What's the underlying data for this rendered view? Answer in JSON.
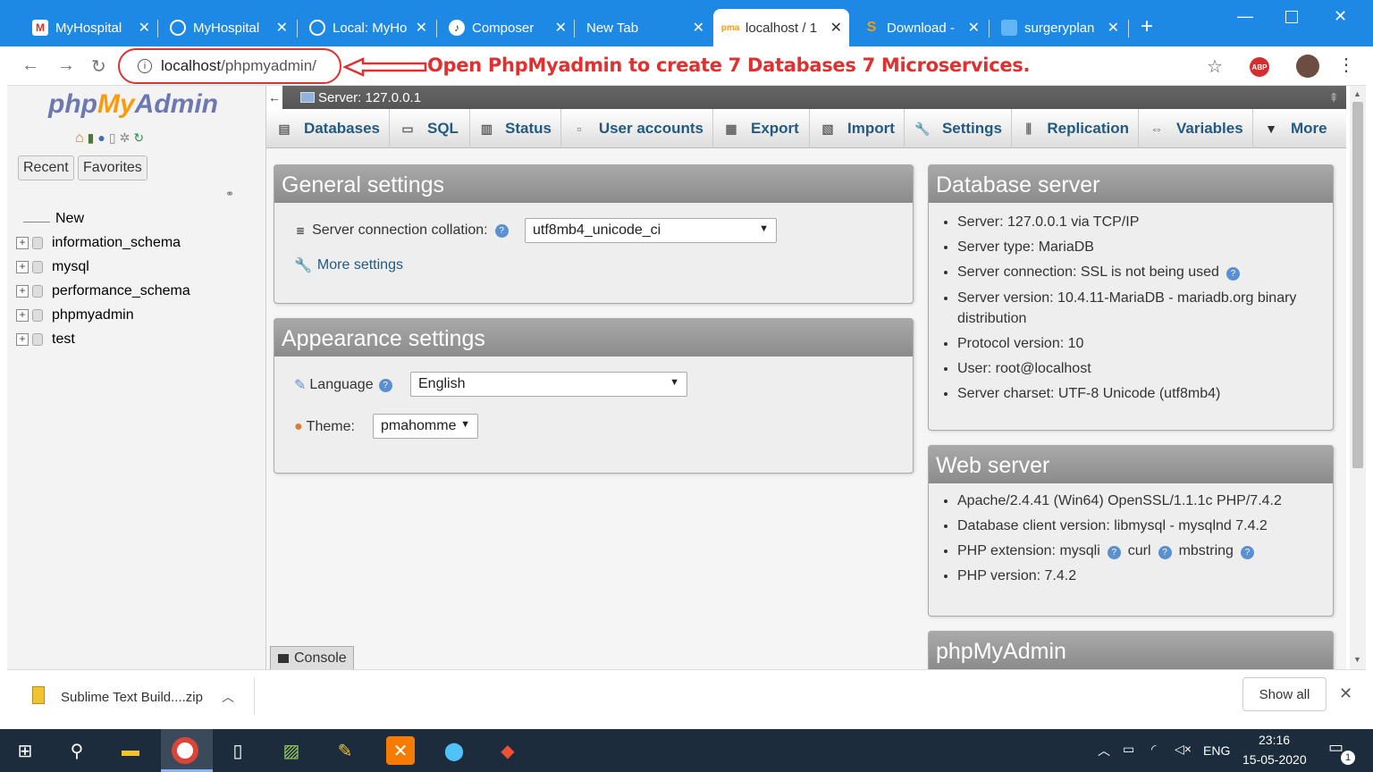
{
  "browser": {
    "tabs": [
      {
        "title": "MyHospital",
        "icon": "gmail-icon"
      },
      {
        "title": "MyHospital",
        "icon": "globe-icon"
      },
      {
        "title": "Local: MyHo",
        "icon": "globe-icon"
      },
      {
        "title": "Composer",
        "icon": "composer-icon"
      },
      {
        "title": "New Tab",
        "icon": ""
      },
      {
        "title": "localhost / 1",
        "icon": "phpmyadmin-icon"
      },
      {
        "title": "Download -",
        "icon": "sublime-icon"
      },
      {
        "title": "surgeryplan",
        "icon": "page-icon"
      }
    ],
    "new_tab": "+",
    "url_host": "localhost",
    "url_path": "/phpmyadmin/",
    "annotation": "Open PhpMyadmin to create 7 Databases 7 Microservices.",
    "abp": "ABP"
  },
  "sidebar": {
    "logo_php": "php",
    "logo_my": "My",
    "logo_admin": "Admin",
    "recent": "Recent",
    "favorites": "Favorites",
    "tree": [
      "New",
      "information_schema",
      "mysql",
      "performance_schema",
      "phpmyadmin",
      "test"
    ]
  },
  "server_bar": "Server: 127.0.0.1",
  "menu": [
    "Databases",
    "SQL",
    "Status",
    "User accounts",
    "Export",
    "Import",
    "Settings",
    "Replication",
    "Variables",
    "More"
  ],
  "general": {
    "title": "General settings",
    "collation_label": "Server connection collation:",
    "collation_value": "utf8mb4_unicode_ci",
    "more_settings": "More settings"
  },
  "appearance": {
    "title": "Appearance settings",
    "language_label": "Language",
    "language_value": "English",
    "theme_label": "Theme:",
    "theme_value": "pmahomme"
  },
  "db_server": {
    "title": "Database server",
    "items": [
      "Server: 127.0.0.1 via TCP/IP",
      "Server type: MariaDB",
      "Server connection: SSL is not being used",
      "Server version: 10.4.11-MariaDB - mariadb.org binary distribution",
      "Protocol version: 10",
      "User: root@localhost",
      "Server charset: UTF-8 Unicode (utf8mb4)"
    ]
  },
  "web_server": {
    "title": "Web server",
    "items": [
      "Apache/2.4.41 (Win64) OpenSSL/1.1.1c PHP/7.4.2",
      "Database client version: libmysql - mysqlnd 7.4.2",
      "PHP extension: mysqli",
      "curl",
      "mbstring",
      "PHP version: 7.4.2"
    ]
  },
  "pma_panel_title": "phpMyAdmin",
  "console": "Console",
  "download": {
    "file": "Sublime Text Build....zip",
    "show_all": "Show all"
  },
  "taskbar": {
    "lang": "ENG",
    "time": "23:16",
    "date": "15-05-2020",
    "notif": "1"
  }
}
